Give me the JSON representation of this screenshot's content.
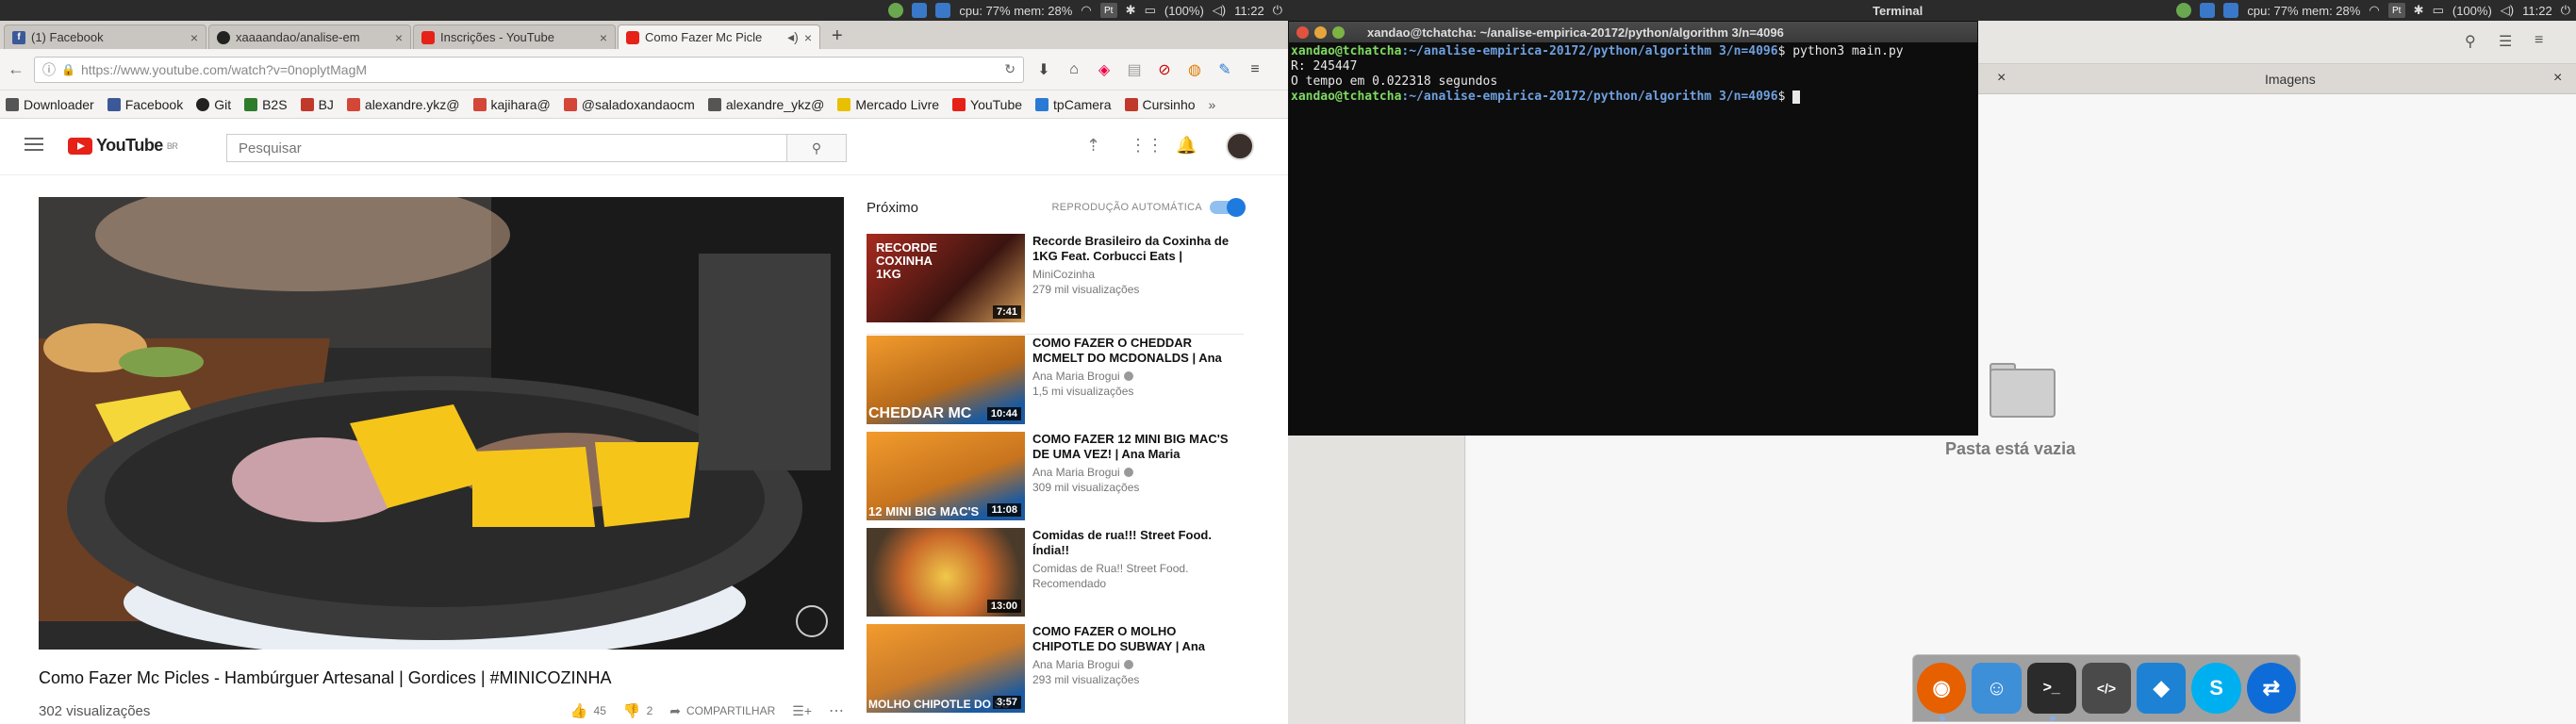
{
  "system_panel": {
    "cpu_mem_text": "cpu: 77% mem: 28%",
    "pt_label": "Pt",
    "battery_text": "(100%)",
    "time": "11:22",
    "active_app": "Terminal"
  },
  "browser": {
    "tabs": [
      {
        "label": "(1) Facebook",
        "favicon": "facebook-icon",
        "active": false
      },
      {
        "label": "xaaaandao/analise-em",
        "favicon": "github-icon",
        "active": false
      },
      {
        "label": "Inscrições - YouTube",
        "favicon": "youtube-icon",
        "active": false
      },
      {
        "label": "Como Fazer Mc Picle",
        "favicon": "youtube-icon",
        "active": true
      }
    ],
    "url": "https://www.youtube.com/watch?v=0noplytMagM",
    "bookmarks": [
      {
        "label": "Downloader",
        "color": "#555555"
      },
      {
        "label": "Facebook",
        "color": "#3b5998"
      },
      {
        "label": "Git",
        "color": "#222222"
      },
      {
        "label": "B2S",
        "color": "#2d7d2d"
      },
      {
        "label": "BJ",
        "color": "#c0392b"
      },
      {
        "label": "alexandre.ykz@",
        "color": "#d44638"
      },
      {
        "label": "kajihara@",
        "color": "#d44638"
      },
      {
        "label": "@saladoxandaocm",
        "color": "#d44638"
      },
      {
        "label": "alexandre_ykz@",
        "color": "#555555"
      },
      {
        "label": "Mercado Livre",
        "color": "#e8c000"
      },
      {
        "label": "YouTube",
        "color": "#e62117"
      },
      {
        "label": "tpCamera",
        "color": "#2a7ad5"
      },
      {
        "label": "Cursinho",
        "color": "#c0392b"
      }
    ]
  },
  "youtube": {
    "logo_text": "YouTube",
    "logo_region": "BR",
    "search_placeholder": "Pesquisar",
    "video_title": "Como Fazer Mc Picles - Hambúrguer Artesanal | Gordices | #MINICOZINHA",
    "video_views": "302 visualizações",
    "likes": "45",
    "dislikes": "2",
    "share_label": "COMPARTILHAR",
    "up_next_label": "Próximo",
    "autoplay_label": "REPRODUÇÃO AUTOMÁTICA",
    "recommendations": [
      {
        "title": "Recorde Brasileiro da Coxinha de 1KG Feat. Corbucci Eats |",
        "channel": "MiniCozinha",
        "views": "279 mil visualizações",
        "duration": "7:41",
        "verified": false,
        "thumb_text": "RECORDE COXINHA 1KG"
      },
      {
        "title": "COMO FAZER O CHEDDAR MCMELT DO MCDONALDS | Ana",
        "channel": "Ana Maria Brogui",
        "views": "1,5 mi visualizações",
        "duration": "10:44",
        "verified": true,
        "thumb_text": "CHEDDAR MC"
      },
      {
        "title": "COMO FAZER 12 MINI BIG MAC'S DE UMA VEZ! | Ana Maria",
        "channel": "Ana Maria Brogui",
        "views": "309 mil visualizações",
        "duration": "11:08",
        "verified": true,
        "thumb_text": "12 MINI BIG MAC'S"
      },
      {
        "title": "Comidas de rua!!! Street Food. Índia!!",
        "channel": "Comidas de Rua!! Street Food.",
        "views": "Recomendado",
        "duration": "13:00",
        "verified": false,
        "thumb_text": ""
      },
      {
        "title": "COMO FAZER O MOLHO CHIPOTLE DO SUBWAY | Ana",
        "channel": "Ana Maria Brogui",
        "views": "293 mil visualizações",
        "duration": "3:57",
        "verified": true,
        "thumb_text": "MOLHO CHIPOTLE DO SU"
      }
    ]
  },
  "terminal": {
    "window_title": "xandao@tchatcha: ~/analise-empirica-20172/python/algorithm 3/n=4096",
    "prompt_user": "xandao@tchatcha",
    "prompt_path": ":~/analise-empirica-20172/python/algorithm 3/n=4096",
    "prompt_symbol": "$ ",
    "command": "python3 main.py",
    "output_lines": [
      "R: 245447",
      "O tempo em 0.022318 segundos"
    ]
  },
  "file_manager": {
    "tab_label": "Imagens",
    "empty_message": "Pasta está vazia"
  },
  "dock": {
    "apps": [
      {
        "name": "firefox-icon",
        "color": "#e66000",
        "glyph": "◉"
      },
      {
        "name": "finder-icon",
        "color": "#3d8fd8",
        "glyph": "☺"
      },
      {
        "name": "terminal-icon",
        "color": "#2b2b2b",
        "glyph": ">_"
      },
      {
        "name": "sublime-icon",
        "color": "#4a4a4a",
        "glyph": "</>"
      },
      {
        "name": "dropbox-icon",
        "color": "#1d82d4",
        "glyph": "◆"
      },
      {
        "name": "skype-icon",
        "color": "#00aff0",
        "glyph": "S"
      },
      {
        "name": "teamviewer-icon",
        "color": "#0e6cd8",
        "glyph": "⇄"
      },
      {
        "name": "matlab-icon",
        "color": "#d9822b",
        "glyph": "▲"
      },
      {
        "name": "postgres-icon",
        "color": "#336791",
        "glyph": "🐘"
      },
      {
        "name": "mysql-workbench-icon",
        "color": "#2f7bc1",
        "glyph": "M"
      },
      {
        "name": "remote-desktop-icon",
        "color": "#607d8b",
        "glyph": "▭"
      },
      {
        "name": "virtualbox-icon",
        "color": "#8fb8e8",
        "glyph": "▣"
      },
      {
        "name": "ubuntu-software-icon",
        "color": "#e95420",
        "glyph": "⧉"
      }
    ]
  }
}
